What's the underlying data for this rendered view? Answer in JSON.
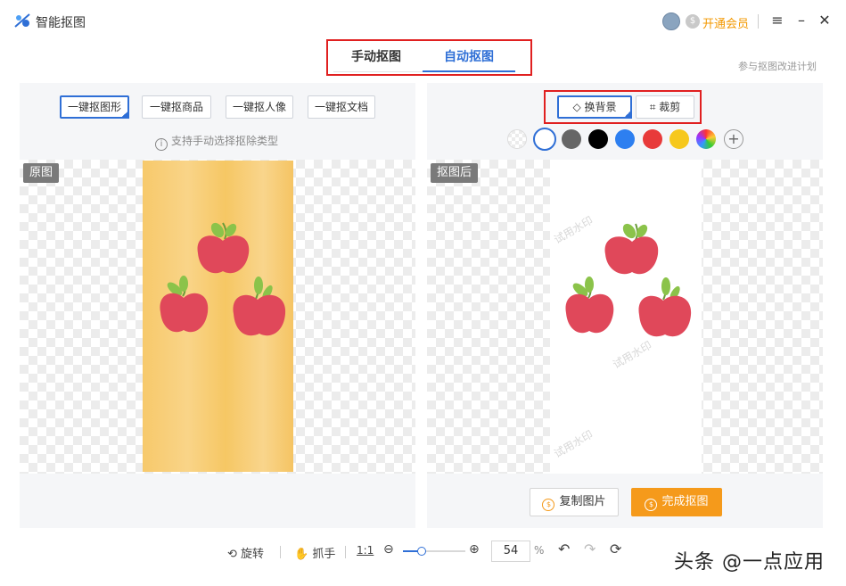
{
  "app": {
    "title": "智能抠图",
    "vip_label": "开通会员",
    "menu_icon": "≡",
    "min_icon": "–",
    "close_icon": "✕"
  },
  "mode_tabs": [
    {
      "label": "手动抠图"
    },
    {
      "label": "自动抠图"
    }
  ],
  "plan_link": "参与抠图改进计划",
  "left_panel": {
    "types": [
      {
        "label": "一键抠图形"
      },
      {
        "label": "一键抠商品"
      },
      {
        "label": "一键抠人像"
      },
      {
        "label": "一键抠文档"
      }
    ],
    "hint": "支持手动选择抠除类型",
    "tag": "原图"
  },
  "right_panel": {
    "tools": [
      {
        "label": "换背景"
      },
      {
        "label": "裁剪"
      }
    ],
    "tag": "抠图后",
    "watermark_text": "试用水印",
    "copy_label": "复制图片",
    "finish_label": "完成抠图",
    "swatch_colors": [
      "transparent",
      "#ffffff",
      "#666666",
      "#000000",
      "#2d7ff0",
      "#e83a3a",
      "#f6c81d",
      "rainbow"
    ]
  },
  "bottom": {
    "rotate": "旋转",
    "hand": "抓手",
    "one_to_one": "1:1",
    "zoom_value": "54",
    "zoom_unit": "%",
    "zoom_level": 0.3
  },
  "overlay_watermark": "头条 @一点应用"
}
